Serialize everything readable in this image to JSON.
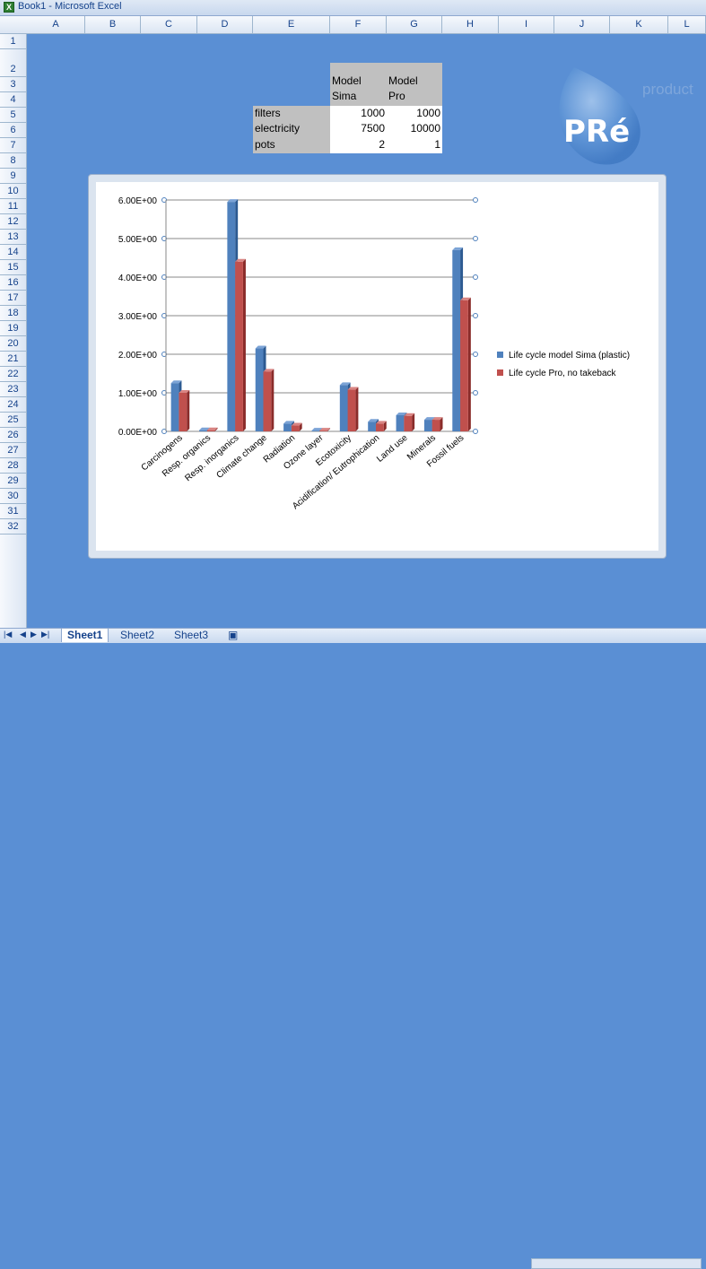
{
  "window": {
    "title": "Book1 - Microsoft Excel",
    "app_icon": "excel-icon"
  },
  "columns": [
    "A",
    "B",
    "C",
    "D",
    "E",
    "F",
    "G",
    "H",
    "I",
    "J",
    "K",
    "L"
  ],
  "rows": [
    "1",
    "2",
    "3",
    "4",
    "5",
    "6",
    "7",
    "8",
    "9",
    "10",
    "11",
    "12",
    "13",
    "14",
    "15",
    "16",
    "17",
    "18",
    "19",
    "20",
    "21",
    "22",
    "23",
    "24",
    "25",
    "26",
    "27",
    "28",
    "29",
    "30",
    "31",
    "32"
  ],
  "table": {
    "header_f": "Model Sima",
    "header_g": "Model Pro",
    "rows": [
      {
        "label": "filters",
        "f": "1000",
        "g": "1000"
      },
      {
        "label": "electricity",
        "f": "7500",
        "g": "10000"
      },
      {
        "label": "pots",
        "f": "2",
        "g": "1"
      }
    ]
  },
  "logo": {
    "text": "PRé",
    "tagline": "product"
  },
  "chart_data": {
    "type": "bar",
    "categories": [
      "Carcinogens",
      "Resp. organics",
      "Resp. inorganics",
      "Climate change",
      "Radiation",
      "Ozone layer",
      "Ecotoxicity",
      "Acidification/ Eutrophication",
      "Land use",
      "Minerals",
      "Fossil fuels"
    ],
    "series": [
      {
        "name": "Life cycle model Sima (plastic)",
        "values": [
          1.25,
          0.03,
          5.95,
          2.15,
          0.2,
          0.02,
          1.2,
          0.25,
          0.42,
          0.3,
          4.7
        ],
        "color": "#4f81bd"
      },
      {
        "name": "Life cycle Pro, no takeback",
        "values": [
          1.0,
          0.03,
          4.4,
          1.55,
          0.15,
          0.02,
          1.08,
          0.2,
          0.4,
          0.3,
          3.4
        ],
        "color": "#c0504d"
      }
    ],
    "yticks": [
      "0.00E+00",
      "1.00E+00",
      "2.00E+00",
      "3.00E+00",
      "4.00E+00",
      "5.00E+00",
      "6.00E+00"
    ],
    "ylim": [
      0,
      6
    ],
    "grid": true,
    "legend": "right"
  },
  "sheets": {
    "tabs": [
      "Sheet1",
      "Sheet2",
      "Sheet3"
    ],
    "active": "Sheet1"
  }
}
